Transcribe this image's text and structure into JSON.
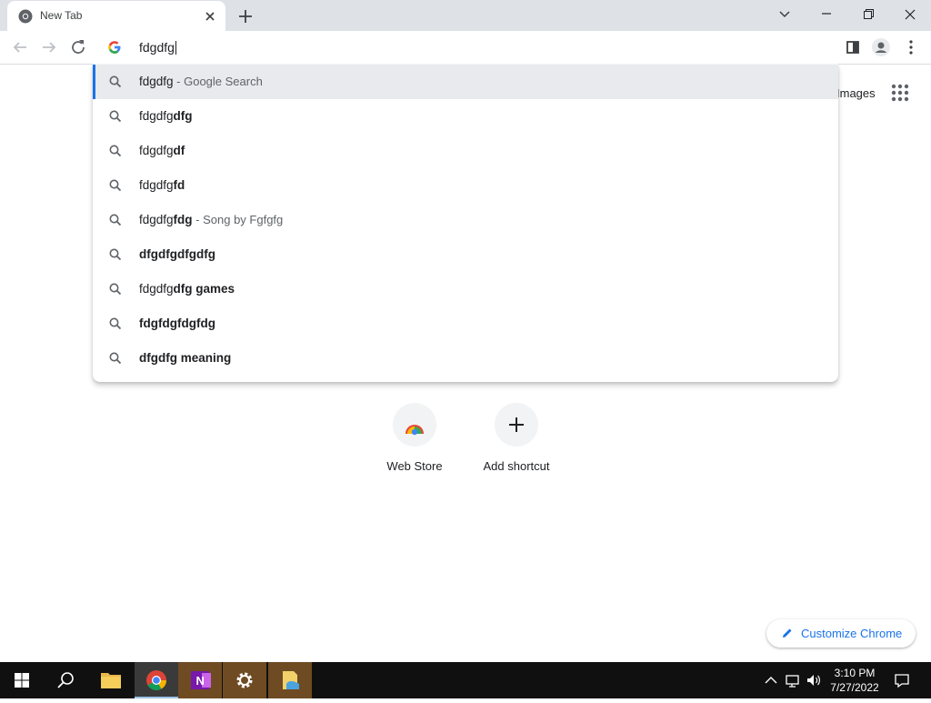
{
  "browser": {
    "tab_title": "New Tab",
    "omnibox_value": "fdgdfg"
  },
  "suggestions": [
    {
      "typed": "fdgdfg",
      "bold": "",
      "desc": " - Google Search",
      "selected": true
    },
    {
      "typed": "fdgdfg",
      "bold": "dfg",
      "desc": ""
    },
    {
      "typed": "fdgdfg",
      "bold": "df",
      "desc": ""
    },
    {
      "typed": "fdgdfg",
      "bold": "fd",
      "desc": ""
    },
    {
      "typed": "fdgdfg",
      "bold": "fdg",
      "desc": " - Song by Fgfgfg"
    },
    {
      "typed": "",
      "bold": "dfgdfgdfgdfg",
      "desc": ""
    },
    {
      "typed": "fdgdfg",
      "bold": "dfg games",
      "desc": ""
    },
    {
      "typed": "",
      "bold": "fdgfdgfdgfdg",
      "desc": ""
    },
    {
      "typed": "",
      "bold": "dfgdfg meaning",
      "desc": ""
    }
  ],
  "ntp": {
    "images_link": "Images",
    "shortcuts": [
      {
        "label": "Web Store"
      },
      {
        "label": "Add shortcut"
      }
    ],
    "customize_label": "Customize Chrome"
  },
  "taskbar": {
    "time": "3:10 PM",
    "date": "7/27/2022"
  },
  "colors": {
    "accent": "#1a73e8",
    "tabstrip": "#dee1e6",
    "taskbar": "#101010"
  }
}
